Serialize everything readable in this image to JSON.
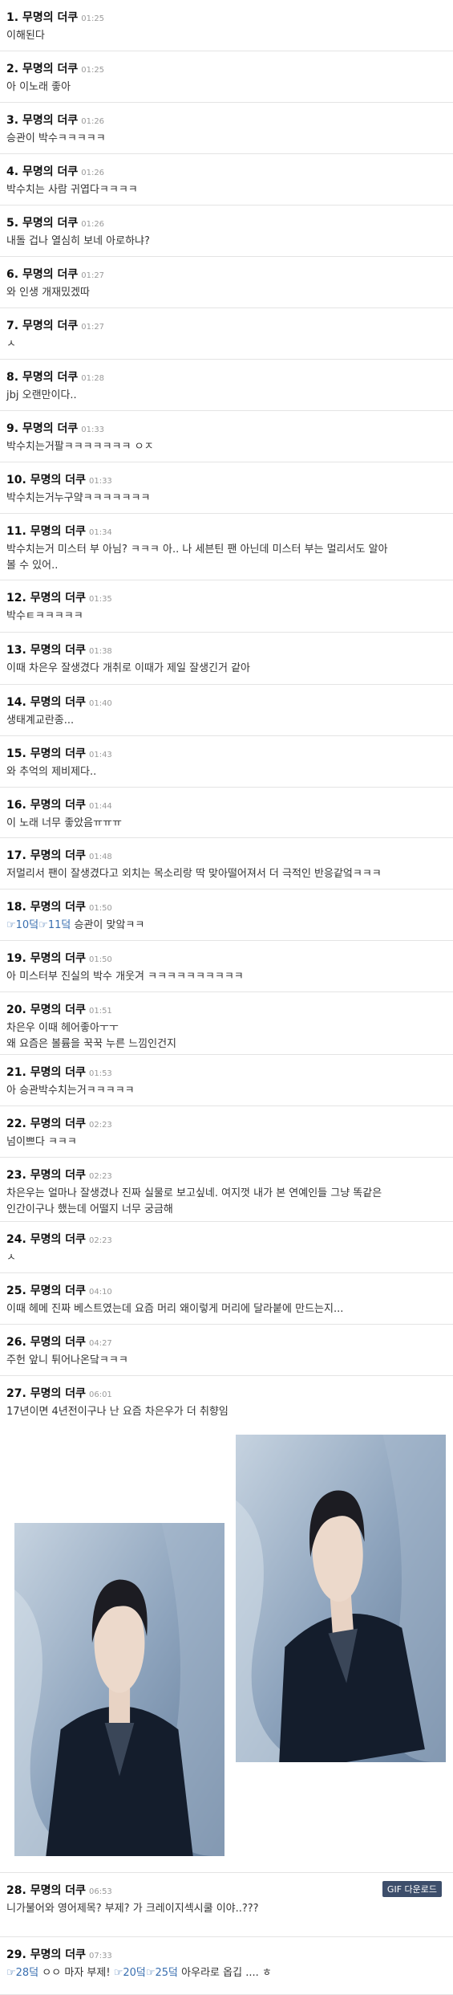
{
  "comments": [
    {
      "num": "1.",
      "author": "무명의 더쿠",
      "time": "01:25",
      "lines": [
        "이해된다"
      ]
    },
    {
      "num": "2.",
      "author": "무명의 더쿠",
      "time": "01:25",
      "lines": [
        "아 이노래 좋아"
      ]
    },
    {
      "num": "3.",
      "author": "무명의 더쿠",
      "time": "01:26",
      "lines": [
        "승관이 박수ㅋㅋㅋㅋㅋ"
      ]
    },
    {
      "num": "4.",
      "author": "무명의 더쿠",
      "time": "01:26",
      "lines": [
        "박수치는 사람 귀엽다ㅋㅋㅋㅋ"
      ]
    },
    {
      "num": "5.",
      "author": "무명의 더쿠",
      "time": "01:26",
      "lines": [
        "내돌 겁나 열심히 보네 아로하냐?"
      ]
    },
    {
      "num": "6.",
      "author": "무명의 더쿠",
      "time": "01:27",
      "lines": [
        "와 인생 개재밌겠따"
      ]
    },
    {
      "num": "7.",
      "author": "무명의 더쿠",
      "time": "01:27",
      "lines": [
        "ㅅ"
      ]
    },
    {
      "num": "8.",
      "author": "무명의 더쿠",
      "time": "01:28",
      "lines": [
        "jbj 오랜만이다.."
      ]
    },
    {
      "num": "9.",
      "author": "무명의 더쿠",
      "time": "01:33",
      "lines": [
        "박수치는거팔ㅋㅋㅋㅋㅋㅋㅋ ㅇㅈ"
      ]
    },
    {
      "num": "10.",
      "author": "무명의 더쿠",
      "time": "01:33",
      "lines": [
        "박수치는거누구얔ㅋㅋㅋㅋㅋㅋㅋ"
      ]
    },
    {
      "num": "11.",
      "author": "무명의 더쿠",
      "time": "01:34",
      "lines": [
        "박수치는거 미스터 부 아님? ㅋㅋㅋ 아.. 나 세븐틴 팬 아닌데 미스터 부는 멀리서도 알아",
        "볼 수 있어.."
      ]
    },
    {
      "num": "12.",
      "author": "무명의 더쿠",
      "time": "01:35",
      "lines": [
        "박수ㅌㅋㅋㅋㅋㅋ"
      ]
    },
    {
      "num": "13.",
      "author": "무명의 더쿠",
      "time": "01:38",
      "lines": [
        "이때 차은우 잘생겼다 개취로 이때가 제일 잘생긴거 같아"
      ]
    },
    {
      "num": "14.",
      "author": "무명의 더쿠",
      "time": "01:40",
      "lines": [
        "생태계교란종..."
      ]
    },
    {
      "num": "15.",
      "author": "무명의 더쿠",
      "time": "01:43",
      "lines": [
        "와 추억의 제비제다.."
      ]
    },
    {
      "num": "16.",
      "author": "무명의 더쿠",
      "time": "01:44",
      "lines": [
        "이 노래 너무 좋았음ㅠㅠㅠ"
      ]
    },
    {
      "num": "17.",
      "author": "무명의 더쿠",
      "time": "01:48",
      "lines": [
        "저멀리서 팬이 잘생겼다고 외치는 목소리랑 딱 맞아떨어져서 더 극적인 반응같엌ㅋㅋㅋ"
      ]
    },
    {
      "num": "18.",
      "author": "무명의 더쿠",
      "time": "01:50",
      "lines": [
        {
          "refs": [
            "☞10덬",
            "☞11덬"
          ],
          "text": " 승관이 맞앜ㅋㅋ"
        }
      ]
    },
    {
      "num": "19.",
      "author": "무명의 더쿠",
      "time": "01:50",
      "lines": [
        "아 미스터부 진실의 박수 개웃겨 ㅋㅋㅋㅋㅋㅋㅋㅋㅋㅋ"
      ]
    },
    {
      "num": "20.",
      "author": "무명의 더쿠",
      "time": "01:51",
      "lines": [
        "차은우 이때 헤어좋아ㅜㅜ",
        "왜 요즘은 볼륨을 꾹꾹 누른 느낌인건지"
      ]
    },
    {
      "num": "21.",
      "author": "무명의 더쿠",
      "time": "01:53",
      "lines": [
        "아 승관박수치는거ㅋㅋㅋㅋㅋ"
      ]
    },
    {
      "num": "22.",
      "author": "무명의 더쿠",
      "time": "02:23",
      "lines": [
        "넘이쁘다 ㅋㅋㅋ"
      ]
    },
    {
      "num": "23.",
      "author": "무명의 더쿠",
      "time": "02:23",
      "lines": [
        "차은우는 얼마나 잘생겼나 진짜 실물로 보고싶네. 여지껏 내가 본 연예인들 그냥 똑같은",
        "인간이구나 했는데 어떨지 너무 궁금해"
      ]
    },
    {
      "num": "24.",
      "author": "무명의 더쿠",
      "time": "02:23",
      "lines": [
        "ㅅ"
      ]
    },
    {
      "num": "25.",
      "author": "무명의 더쿠",
      "time": "04:10",
      "lines": [
        "이때 헤메 진짜 베스트였는데 요즘 머리 왜이렇게 머리에 달라붙에 만드는지..."
      ]
    },
    {
      "num": "26.",
      "author": "무명의 더쿠",
      "time": "04:27",
      "lines": [
        "주헌 앞니 튀어나온닼ㅋㅋㅋ"
      ]
    },
    {
      "num": "27.",
      "author": "무명의 더쿠",
      "time": "06:01",
      "lines": [
        "17년이면 4년전이구나 난 요즘 차은우가 더 취향임"
      ],
      "gif_label": "GIF 다운로드"
    },
    {
      "num": "28.",
      "author": "무명의 더쿠",
      "time": "06:53",
      "lines": [
        "니가불어와 영어제목? 부제? 가 크레이지섹시쿨 이야..???"
      ]
    },
    {
      "num": "29.",
      "author": "무명의 더쿠",
      "time": "07:33",
      "lines": [
        {
          "refs": [
            "☞28덬"
          ],
          "text": " ㅇㅇ 마자 부제! "
        },
        {
          "refs": [
            "☞20덬",
            "☞25덬"
          ],
          "text": " 아우라로 옵깁 .... ㅎ"
        }
      ]
    }
  ]
}
